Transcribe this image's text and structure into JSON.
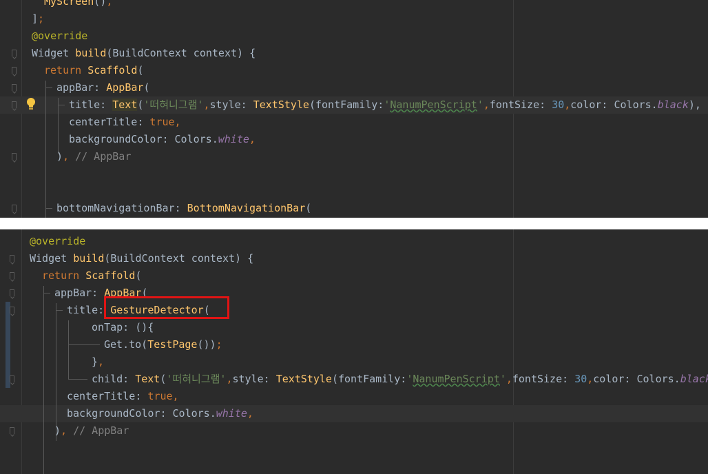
{
  "top_panel": {
    "lines": [
      {
        "id": "myscreen",
        "segments": [
          {
            "text": "MyScreen",
            "style": "fn"
          },
          {
            "text": "()",
            "style": "plain"
          },
          {
            "text": ",",
            "style": "kw"
          }
        ]
      },
      {
        "id": "list-close",
        "segments": [
          {
            "text": "]",
            "style": "plain"
          },
          {
            "text": ";",
            "style": "kw"
          }
        ]
      },
      {
        "id": "override",
        "segments": [
          {
            "text": "@override",
            "style": "ann"
          }
        ]
      },
      {
        "id": "build",
        "segments": [
          {
            "text": "Widget ",
            "style": "plain"
          },
          {
            "text": "build",
            "style": "fn"
          },
          {
            "text": "(BuildContext context) {",
            "style": "plain"
          }
        ]
      },
      {
        "id": "return",
        "segments": [
          {
            "text": "return ",
            "style": "kw"
          },
          {
            "text": "Scaffold",
            "style": "fn"
          },
          {
            "text": "(",
            "style": "plain"
          }
        ]
      },
      {
        "id": "appbar",
        "segments": [
          {
            "text": "appBar: ",
            "style": "plain"
          },
          {
            "text": "AppBar",
            "style": "fn"
          },
          {
            "text": "(",
            "style": "plain"
          }
        ]
      },
      {
        "id": "title",
        "segments": [
          {
            "text": "title: ",
            "style": "plain"
          },
          {
            "text": "Text",
            "style": "fn hl"
          },
          {
            "text": "(",
            "style": "plain"
          },
          {
            "text": "'떠혀니그램'",
            "style": "str"
          },
          {
            "text": ",",
            "style": "kw"
          },
          {
            "text": "style: ",
            "style": "plain"
          },
          {
            "text": "TextStyle",
            "style": "fn"
          },
          {
            "text": "(fontFamily:",
            "style": "plain"
          },
          {
            "text": "'",
            "style": "str"
          },
          {
            "text": "NanumPenScript",
            "style": "str sq"
          },
          {
            "text": "'",
            "style": "str"
          },
          {
            "text": ",",
            "style": "kw"
          },
          {
            "text": "fontSize: ",
            "style": "plain"
          },
          {
            "text": "30",
            "style": "num"
          },
          {
            "text": ",",
            "style": "kw"
          },
          {
            "text": "color: Colors.",
            "style": "plain"
          },
          {
            "text": "black",
            "style": "it"
          },
          {
            "text": "),",
            "style": "plain"
          }
        ]
      },
      {
        "id": "centertitle",
        "segments": [
          {
            "text": "centerTitle: ",
            "style": "plain"
          },
          {
            "text": "true",
            "style": "kw"
          },
          {
            "text": ",",
            "style": "kw"
          }
        ]
      },
      {
        "id": "bgcolor",
        "segments": [
          {
            "text": "backgroundColor: Colors.",
            "style": "plain"
          },
          {
            "text": "white",
            "style": "it"
          },
          {
            "text": ",",
            "style": "kw"
          }
        ]
      },
      {
        "id": "appbar-close",
        "segments": [
          {
            "text": ")",
            "style": "plain"
          },
          {
            "text": ", ",
            "style": "kw"
          },
          {
            "text": "// AppBar",
            "style": "cm"
          }
        ]
      },
      {
        "id": "bottomnav",
        "segments": [
          {
            "text": "bottomNavigationBar: ",
            "style": "plain"
          },
          {
            "text": "BottomNavigationBar",
            "style": "fn"
          },
          {
            "text": "(",
            "style": "plain"
          }
        ]
      }
    ]
  },
  "bottom_panel": {
    "lines": [
      {
        "id": "override",
        "segments": [
          {
            "text": "@override",
            "style": "ann"
          }
        ]
      },
      {
        "id": "build",
        "segments": [
          {
            "text": "Widget ",
            "style": "plain"
          },
          {
            "text": "build",
            "style": "fn"
          },
          {
            "text": "(BuildContext context) {",
            "style": "plain"
          }
        ]
      },
      {
        "id": "return",
        "segments": [
          {
            "text": "return ",
            "style": "kw"
          },
          {
            "text": "Scaffold",
            "style": "fn"
          },
          {
            "text": "(",
            "style": "plain"
          }
        ]
      },
      {
        "id": "appbar",
        "segments": [
          {
            "text": "appBar: ",
            "style": "plain"
          },
          {
            "text": "AppBar",
            "style": "fn"
          },
          {
            "text": "(",
            "style": "plain"
          }
        ]
      },
      {
        "id": "title",
        "segments": [
          {
            "text": "title: ",
            "style": "plain"
          },
          {
            "text": "GestureDetector",
            "style": "fn"
          },
          {
            "text": "(",
            "style": "plain"
          }
        ]
      },
      {
        "id": "ontap",
        "segments": [
          {
            "text": "onTap: (){",
            "style": "plain"
          }
        ]
      },
      {
        "id": "getto",
        "segments": [
          {
            "text": "Get.to(",
            "style": "plain"
          },
          {
            "text": "TestPage",
            "style": "fn"
          },
          {
            "text": "())",
            "style": "plain"
          },
          {
            "text": ";",
            "style": "kw"
          }
        ]
      },
      {
        "id": "ontap-close",
        "segments": [
          {
            "text": "}",
            "style": "plain"
          },
          {
            "text": ",",
            "style": "kw"
          }
        ]
      },
      {
        "id": "child",
        "segments": [
          {
            "text": "child: ",
            "style": "plain"
          },
          {
            "text": "Text",
            "style": "fn"
          },
          {
            "text": "(",
            "style": "plain"
          },
          {
            "text": "'떠혀니그램'",
            "style": "str"
          },
          {
            "text": ",",
            "style": "kw"
          },
          {
            "text": "style: ",
            "style": "plain"
          },
          {
            "text": "TextStyle",
            "style": "fn"
          },
          {
            "text": "(fontFamily:",
            "style": "plain"
          },
          {
            "text": "'",
            "style": "str"
          },
          {
            "text": "NanumPenScript",
            "style": "str sq"
          },
          {
            "text": "'",
            "style": "str"
          },
          {
            "text": ",",
            "style": "kw"
          },
          {
            "text": "fontSize: ",
            "style": "plain"
          },
          {
            "text": "30",
            "style": "num"
          },
          {
            "text": ",",
            "style": "kw"
          },
          {
            "text": "color: Colors.",
            "style": "plain"
          },
          {
            "text": "black",
            "style": "it"
          }
        ]
      },
      {
        "id": "centertitle",
        "segments": [
          {
            "text": "centerTitle: ",
            "style": "plain"
          },
          {
            "text": "true",
            "style": "kw"
          },
          {
            "text": ",",
            "style": "kw"
          }
        ]
      },
      {
        "id": "bgcolor",
        "segments": [
          {
            "text": "backgroundColor: Colors.",
            "style": "plain"
          },
          {
            "text": "white",
            "style": "it"
          },
          {
            "text": ",",
            "style": "kw"
          }
        ]
      },
      {
        "id": "appbar-close",
        "segments": [
          {
            "text": ")",
            "style": "plain"
          },
          {
            "text": ", ",
            "style": "kw"
          },
          {
            "text": "// AppBar",
            "style": "cm"
          }
        ]
      }
    ]
  },
  "icons": {
    "intention": "lightbulb-icon",
    "fold": "fold-marker-icon"
  },
  "colors": {
    "background": "#2b2b2b",
    "keyword": "#cc7832",
    "function": "#ffc66d",
    "annotation": "#bbb529",
    "string": "#6a8759",
    "number": "#6897bb",
    "field": "#9876aa",
    "comment": "#808080",
    "highlight_box": "#e01414"
  }
}
